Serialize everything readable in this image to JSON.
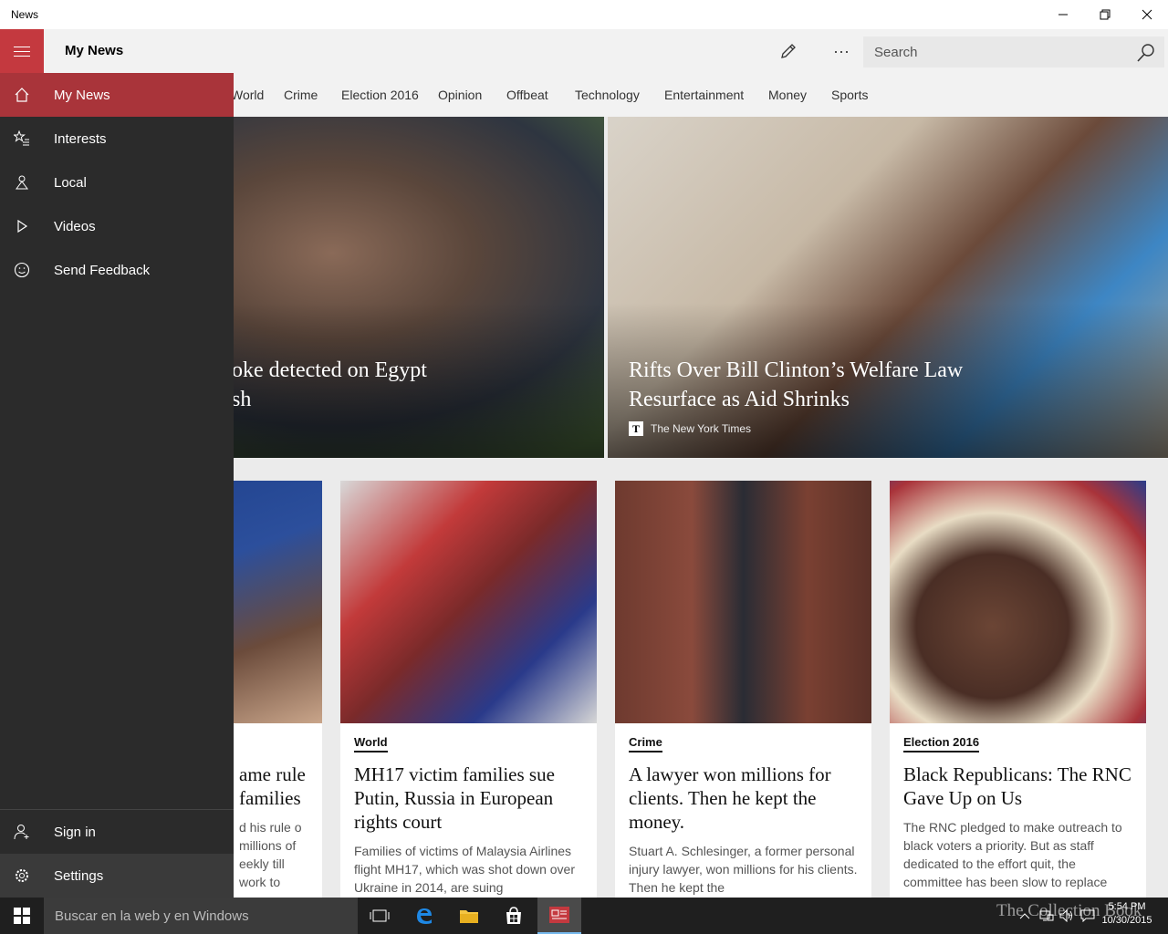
{
  "window": {
    "app_title": "News",
    "minimize_icon": "minimize-icon",
    "restore_icon": "restore-icon",
    "close_icon": "close-icon"
  },
  "appbar": {
    "page_title": "My News",
    "edit_icon": "pencil-icon",
    "more_label": "···",
    "search_placeholder": "Search"
  },
  "tabs": [
    "World",
    "Crime",
    "Election 2016",
    "Opinion",
    "Offbeat",
    "Technology",
    "Entertainment",
    "Money",
    "Sports"
  ],
  "drawer": {
    "items": [
      {
        "label": "My News",
        "icon": "home-icon",
        "active": true
      },
      {
        "label": "Interests",
        "icon": "star-list-icon"
      },
      {
        "label": "Local",
        "icon": "local-icon"
      },
      {
        "label": "Videos",
        "icon": "play-icon"
      },
      {
        "label": "Send Feedback",
        "icon": "smiley-icon"
      }
    ],
    "bottom_items": [
      {
        "label": "Sign in",
        "icon": "person-add-icon"
      },
      {
        "label": "Settings",
        "icon": "gear-icon"
      }
    ]
  },
  "hero": [
    {
      "title_line1": "oke detected on Egypt",
      "title_line2": "sh",
      "source": ""
    },
    {
      "title_line1": "Rifts Over Bill Clinton’s Welfare Law",
      "title_line2": "Resurface as Aid Shrinks",
      "source": "The New York Times",
      "source_icon": "T"
    }
  ],
  "cards": [
    {
      "category": "",
      "title": "ame rule families",
      "summary": "d his rule o millions of eekly till work to"
    },
    {
      "category": "World",
      "title": "MH17 victim families sue Putin, Russia in European rights court",
      "summary": "Families of victims of Malaysia Airlines flight MH17, which was shot down over Ukraine in 2014, are suing"
    },
    {
      "category": "Crime",
      "title": "A lawyer won millions for clients. Then he kept the money.",
      "summary": "Stuart A. Schlesinger, a former personal injury lawyer, won millions for his clients. Then he kept the"
    },
    {
      "category": "Election 2016",
      "title": "Black Republicans: The RNC Gave Up on Us",
      "summary": "The RNC pledged to make outreach to black voters a priority. But as staff dedicated to the effort quit, the committee has been slow to replace"
    }
  ],
  "taskbar": {
    "search_placeholder": "Buscar en la web y en Windows",
    "watermark": "The Collection Book",
    "time": "5:54 PM",
    "date": "10/30/2015"
  },
  "colors": {
    "accent": "#c4393f",
    "accent_active": "#a9343a",
    "drawer_bg": "#2b2b2b",
    "taskbar_bg": "#1f1f1f"
  }
}
